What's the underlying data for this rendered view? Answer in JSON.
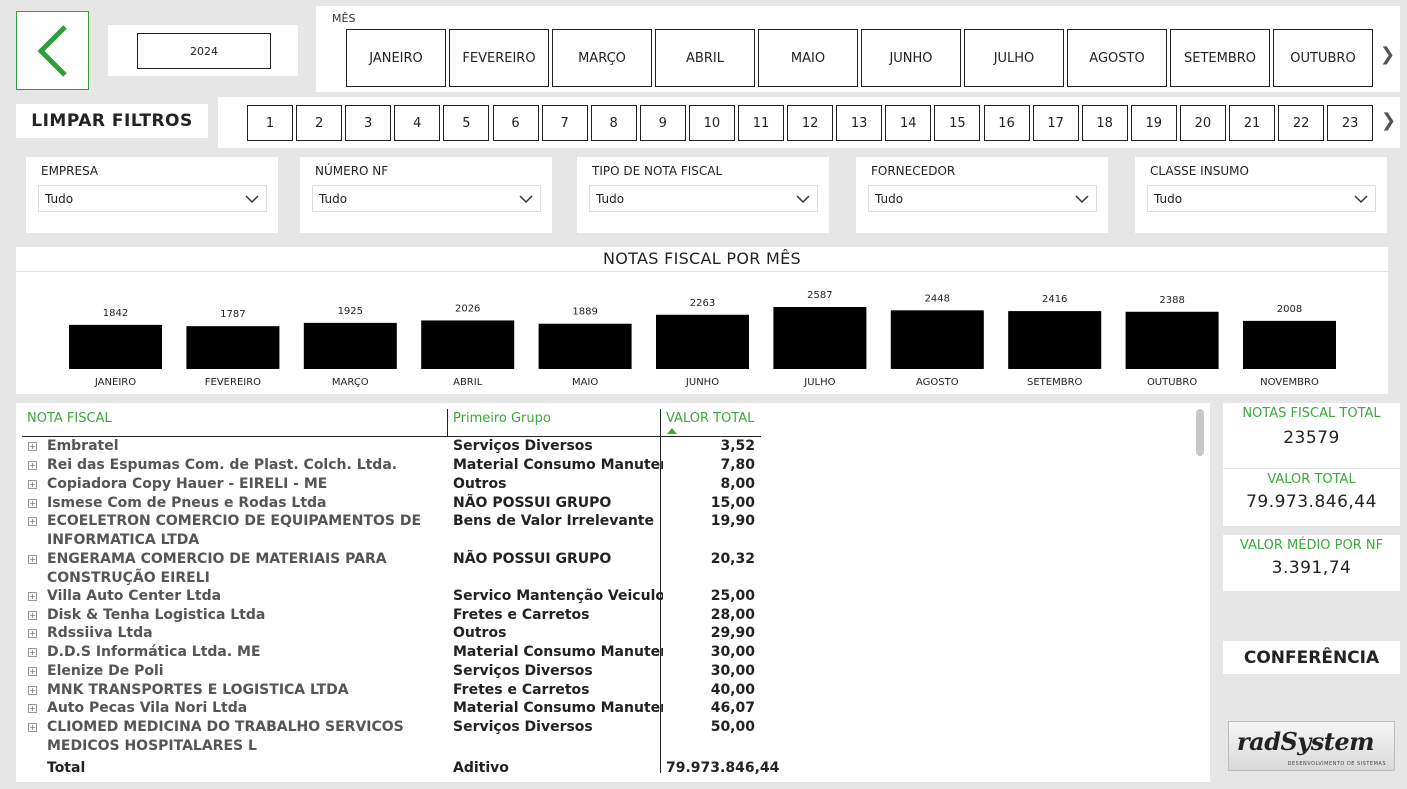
{
  "back_button": {
    "label": "voltar",
    "icon": "chevron-left-icon",
    "color": "#2e9e3a"
  },
  "year": {
    "value": "2024"
  },
  "months": {
    "title": "MÊS",
    "items": [
      "JANEIRO",
      "FEVEREIRO",
      "MARÇO",
      "ABRIL",
      "MAIO",
      "JUNHO",
      "JULHO",
      "AGOSTO",
      "SETEMBRO",
      "OUTUBRO"
    ]
  },
  "clear_filters": {
    "label": "LIMPAR FILTROS"
  },
  "days": {
    "items": [
      "1",
      "2",
      "3",
      "4",
      "5",
      "6",
      "7",
      "8",
      "9",
      "10",
      "11",
      "12",
      "13",
      "14",
      "15",
      "16",
      "17",
      "18",
      "19",
      "20",
      "21",
      "22",
      "23"
    ]
  },
  "filters": [
    {
      "label": "EMPRESA",
      "value": "Tudo"
    },
    {
      "label": "NÚMERO NF",
      "value": "Tudo"
    },
    {
      "label": "TIPO DE NOTA FISCAL",
      "value": "Tudo"
    },
    {
      "label": "FORNECEDOR",
      "value": "Tudo"
    },
    {
      "label": "CLASSE INSUMO",
      "value": "Tudo"
    }
  ],
  "chart_data": {
    "type": "bar",
    "title": "NOTAS FISCAL POR MÊS",
    "categories": [
      "JANEIRO",
      "FEVEREIRO",
      "MARÇO",
      "ABRIL",
      "MAIO",
      "JUNHO",
      "JULHO",
      "AGOSTO",
      "SETEMBRO",
      "OUTUBRO",
      "NOVEMBRO"
    ],
    "values": [
      1842,
      1787,
      1925,
      2026,
      1889,
      2263,
      2587,
      2448,
      2416,
      2388,
      2008
    ],
    "xlabel": "",
    "ylabel": "",
    "bar_color": "#000000",
    "grid": false,
    "data_labels": true
  },
  "table": {
    "headers": {
      "name": "NOTA FISCAL",
      "group": "Primeiro Grupo",
      "value": "VALOR TOTAL"
    },
    "header_color": "#3aa83a",
    "rows": [
      {
        "name": "Embratel",
        "group": "Serviços Diversos",
        "value": "3,52"
      },
      {
        "name": "Rei das Espumas Com. de Plast. Colch. Ltda.",
        "group": "Material Consumo Manutenção",
        "value": "7,80"
      },
      {
        "name": "Copiadora Copy Hauer - EIRELI - ME",
        "group": "Outros",
        "value": "8,00"
      },
      {
        "name": "Ismese Com de Pneus e Rodas Ltda",
        "group": "NÃO POSSUI GRUPO",
        "value": "15,00"
      },
      {
        "name": "ECOELETRON COMERCIO DE EQUIPAMENTOS DE INFORMATICA LTDA",
        "group": "Bens de Valor Irrelevante",
        "value": "19,90"
      },
      {
        "name": "ENGERAMA COMERCIO DE MATERIAIS PARA CONSTRUÇÃO EIRELI",
        "group": "NÃO POSSUI GRUPO",
        "value": "20,32"
      },
      {
        "name": "Villa Auto Center Ltda",
        "group": "Servico Mantenção Veiculos",
        "value": "25,00"
      },
      {
        "name": "Disk & Tenha Logistica Ltda",
        "group": "Fretes e Carretos",
        "value": "28,00"
      },
      {
        "name": "Rdssiiva Ltda",
        "group": "Outros",
        "value": "29,90"
      },
      {
        "name": "D.D.S Informática Ltda. ME",
        "group": "Material Consumo Manutenção",
        "value": "30,00"
      },
      {
        "name": "Elenize De Poli",
        "group": "Serviços Diversos",
        "value": "30,00"
      },
      {
        "name": "MNK TRANSPORTES E LOGISTICA LTDA",
        "group": "Fretes e Carretos",
        "value": "40,00"
      },
      {
        "name": "Auto Pecas Vila Nori Ltda",
        "group": "Material Consumo Manutenção",
        "value": "46,07"
      },
      {
        "name": "CLIOMED MEDICINA DO TRABALHO SERVICOS MEDICOS HOSPITALARES L",
        "group": "Serviços Diversos",
        "value": "50,00"
      }
    ],
    "total": {
      "name": "Total",
      "group": "Aditivo",
      "value": "79.973.846,44"
    }
  },
  "kpis": [
    {
      "label": "NOTAS FISCAL TOTAL",
      "value": "23579"
    },
    {
      "label": "VALOR TOTAL",
      "value": "79.973.846,44"
    },
    {
      "label": "VALOR MÉDIO POR NF",
      "value": "3.391,74"
    }
  ],
  "conference_button": {
    "label": "CONFERÊNCIA"
  },
  "logo": {
    "text": "radSystem",
    "subtitle": "DESENVOLVIMENTO DE SISTEMAS"
  }
}
